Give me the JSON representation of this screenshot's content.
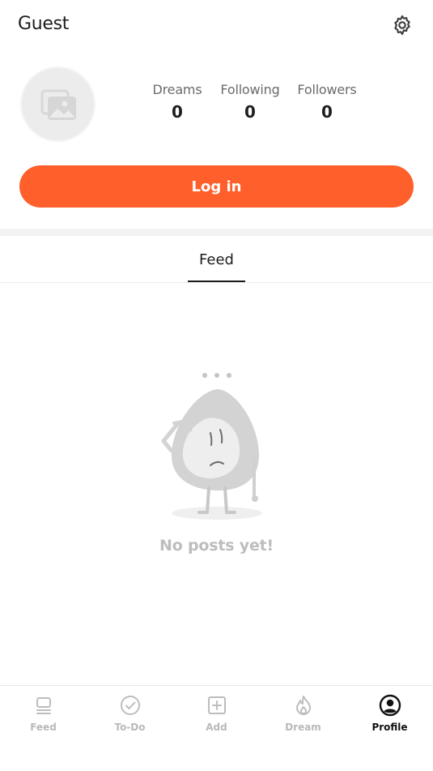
{
  "header": {
    "title": "Guest",
    "settings_icon": "gear-icon"
  },
  "profile": {
    "avatar_icon": "image-placeholder-icon",
    "stats": [
      {
        "label": "Dreams",
        "value": "0"
      },
      {
        "label": "Following",
        "value": "0"
      },
      {
        "label": "Followers",
        "value": "0"
      }
    ],
    "login_label": "Log in"
  },
  "tabs": {
    "feed_label": "Feed"
  },
  "empty_state": {
    "message": "No posts yet!"
  },
  "bottom_nav": {
    "items": [
      {
        "label": "Feed",
        "icon": "feed-icon"
      },
      {
        "label": "To-Do",
        "icon": "check-circle-icon"
      },
      {
        "label": "Add",
        "icon": "add-square-icon"
      },
      {
        "label": "Dream",
        "icon": "flame-icon"
      },
      {
        "label": "Profile",
        "icon": "profile-icon"
      }
    ],
    "active": "Profile"
  },
  "colors": {
    "accent": "#ff5f2b",
    "muted": "#bdbdbd",
    "text": "#1f1f1f"
  }
}
